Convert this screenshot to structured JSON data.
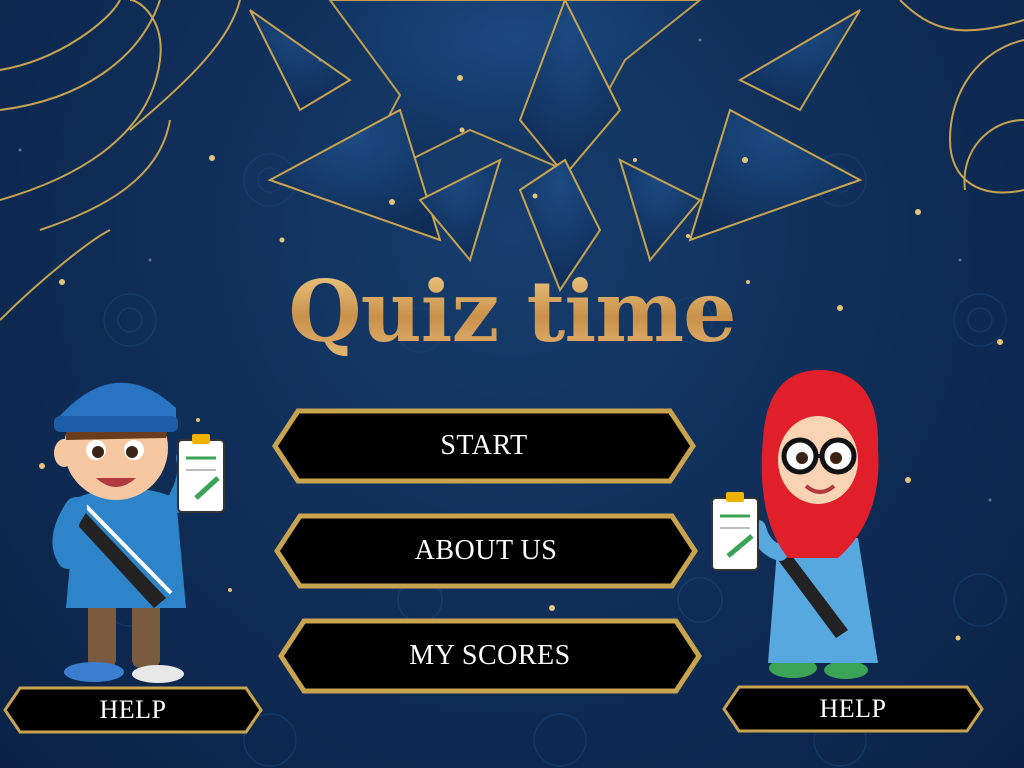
{
  "title": "Quiz time",
  "menu": {
    "start_label": "START",
    "about_label": "ABOUT US",
    "scores_label": "MY SCORES"
  },
  "help_left_label": "HELP",
  "help_right_label": "HELP",
  "colors": {
    "background": "#0f2d55",
    "gold": "#c9a44f",
    "button_fill": "#000000",
    "button_text": "#ffffff"
  },
  "icons": {
    "boy": "boy-with-clipboard-icon",
    "girl": "girl-with-clipboard-icon"
  }
}
